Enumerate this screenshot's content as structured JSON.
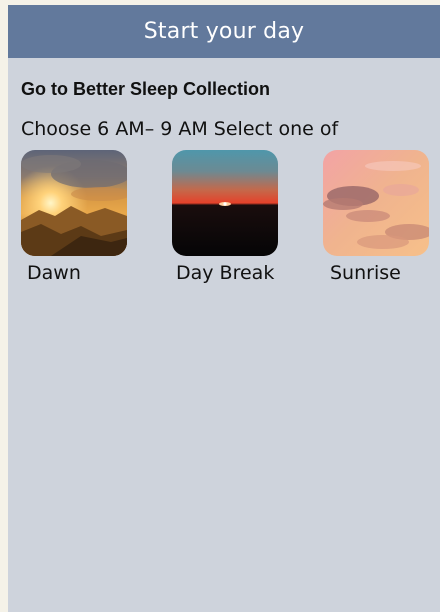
{
  "header": {
    "title": "Start your day",
    "color": "#62799c"
  },
  "collection": {
    "title": "Go to Better Sleep Collection",
    "subtitle": "Choose 6 AM– 9 AM Select one of"
  },
  "options": [
    {
      "label": "Dawn",
      "image": "dawn-sky-over-mountains"
    },
    {
      "label": "Day Break",
      "image": "red-sun-on-dark-horizon"
    },
    {
      "label": "Sunrise",
      "image": "pink-clouds-sky"
    }
  ],
  "colors": {
    "background": "#ced3dc",
    "text": "#111111"
  }
}
